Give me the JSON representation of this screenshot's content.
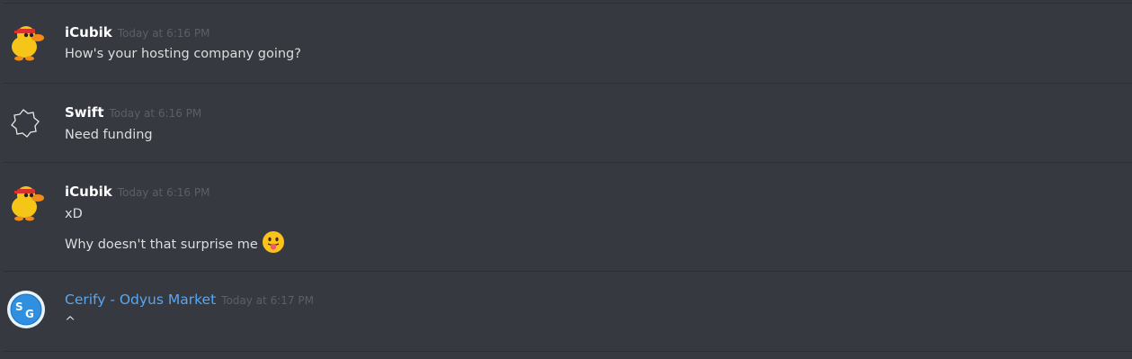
{
  "messages": [
    {
      "username": "iCubik",
      "timestamp": "Today at 6:16 PM",
      "avatar_icon": "duck-avatar-icon",
      "lines": [
        "How's your hosting company going?"
      ]
    },
    {
      "username": "Swift",
      "timestamp": "Today at 6:16 PM",
      "avatar_icon": "star-outline-avatar-icon",
      "lines": [
        "Need funding"
      ]
    },
    {
      "username": "iCubik",
      "timestamp": "Today at 6:16 PM",
      "avatar_icon": "duck-avatar-icon",
      "lines": [
        "xD",
        "Why doesn't that surprise me"
      ],
      "emoji": "tongue-out-emoji-icon"
    },
    {
      "username": "Cerify - Odyus Market",
      "timestamp": "Today at 6:17 PM",
      "avatar_icon": "sg-avatar-icon",
      "avatar_text": "SG",
      "lines": [
        "^"
      ],
      "username_color": "#5aa6f0"
    }
  ],
  "colors": {
    "background": "#36393f",
    "divider": "#2c2e33",
    "username": "#ffffff",
    "message_text": "#dcddde",
    "timestamp": "#5c5f66"
  }
}
